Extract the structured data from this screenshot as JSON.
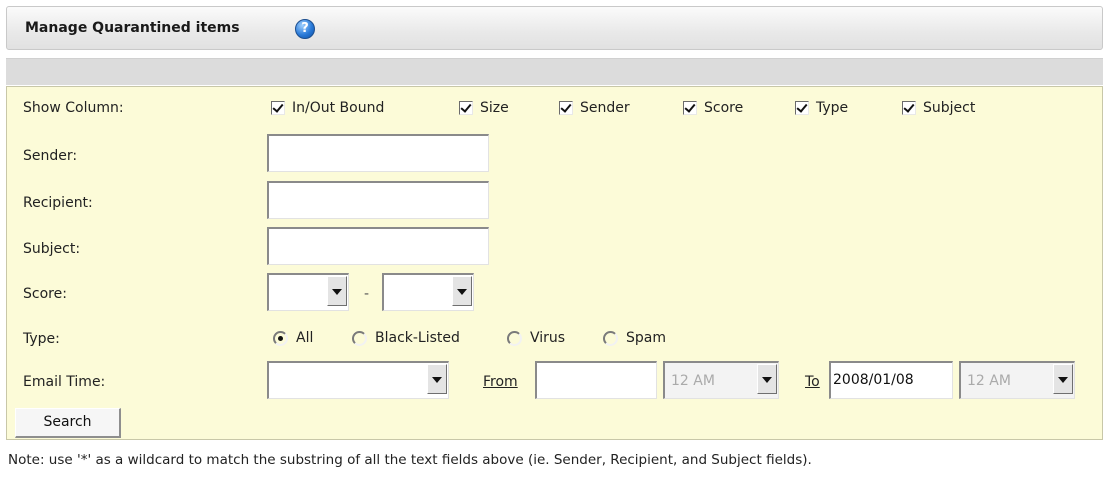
{
  "header": {
    "title": "Manage Quarantined items",
    "help_icon": "help-icon"
  },
  "form": {
    "show_column": {
      "label": "Show Column:",
      "options": [
        {
          "label": "In/Out Bound",
          "checked": true
        },
        {
          "label": "Size",
          "checked": true
        },
        {
          "label": "Sender",
          "checked": true
        },
        {
          "label": "Score",
          "checked": true
        },
        {
          "label": "Type",
          "checked": true
        },
        {
          "label": "Subject",
          "checked": true
        }
      ]
    },
    "sender": {
      "label": "Sender:",
      "value": ""
    },
    "recipient": {
      "label": "Recipient:",
      "value": ""
    },
    "subject": {
      "label": "Subject:",
      "value": ""
    },
    "score": {
      "label": "Score:",
      "min_value": "",
      "max_value": "",
      "separator": "-"
    },
    "type": {
      "label": "Type:",
      "options": [
        {
          "label": "All",
          "selected": true
        },
        {
          "label": "Black-Listed",
          "selected": false
        },
        {
          "label": "Virus",
          "selected": false
        },
        {
          "label": "Spam",
          "selected": false
        }
      ]
    },
    "email_time": {
      "label": "Email Time:",
      "value": "",
      "from_label": "From",
      "from_date": "",
      "from_hour": "12 AM",
      "to_label": "To",
      "to_date": "2008/01/08",
      "to_hour": "12 AM"
    },
    "search_button": "Search"
  },
  "note": "Note: use '*' as a wildcard to match the substring of all the text fields above (ie. Sender, Recipient, and Subject fields)."
}
